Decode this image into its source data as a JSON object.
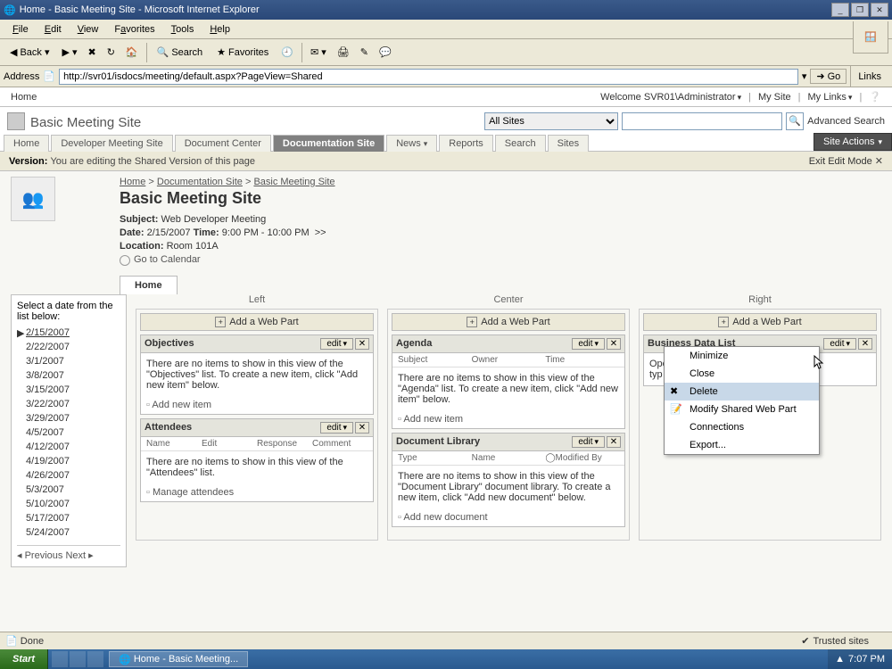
{
  "window": {
    "title": "Home - Basic Meeting Site - Microsoft Internet Explorer",
    "min": "_",
    "max": "▢",
    "restore": "❐",
    "close": "✕"
  },
  "menus": {
    "file": "File",
    "edit": "Edit",
    "view": "View",
    "favorites": "Favorites",
    "tools": "Tools",
    "help": "Help"
  },
  "toolbar": {
    "back": "Back",
    "search": "Search",
    "favorites": "Favorites"
  },
  "address": {
    "label": "Address",
    "url": "http://svr01/isdocs/meeting/default.aspx?PageView=Shared",
    "go": "Go",
    "links": "Links"
  },
  "sp_header": {
    "home": "Home",
    "welcome": "Welcome SVR01\\Administrator",
    "mysite": "My Site",
    "mylinks": "My Links"
  },
  "site_title": "Basic Meeting Site",
  "search": {
    "scope": "All Sites",
    "adv": "Advanced Search"
  },
  "tabs": [
    "Home",
    "Developer Meeting Site",
    "Document Center",
    "Documentation Site",
    "News",
    "Reports",
    "Search",
    "Sites"
  ],
  "active_tab": "Documentation Site",
  "site_actions": "Site Actions",
  "version": {
    "label": "Version:",
    "text": "You are editing the Shared Version of this page",
    "exit": "Exit Edit Mode",
    "x": "✕"
  },
  "breadcrumb": {
    "home": "Home",
    "doc": "Documentation Site",
    "bms": "Basic Meeting Site"
  },
  "page_title": "Basic Meeting Site",
  "meta": {
    "subject_label": "Subject:",
    "subject": "Web Developer Meeting",
    "date_label": "Date:",
    "date": "2/15/2007",
    "time_label": "Time:",
    "time": "9:00 PM - 10:00 PM",
    "more": ">>",
    "loc_label": "Location:",
    "loc": "Room 101A",
    "gotocal": "Go to Calendar"
  },
  "sidetab": "Home",
  "leftnav": {
    "prompt": "Select a date from the list below:",
    "dates": [
      "2/15/2007",
      "2/22/2007",
      "3/1/2007",
      "3/8/2007",
      "3/15/2007",
      "3/22/2007",
      "3/29/2007",
      "4/5/2007",
      "4/12/2007",
      "4/19/2007",
      "4/26/2007",
      "5/3/2007",
      "5/10/2007",
      "5/17/2007",
      "5/24/2007"
    ],
    "selected": "2/15/2007",
    "prev": "Previous",
    "next": "Next"
  },
  "zones": {
    "left": "Left",
    "center": "Center",
    "right": "Right",
    "addwp": "Add a Web Part"
  },
  "webparts": {
    "objectives": {
      "title": "Objectives",
      "empty": "There are no items to show in this view of the \"Objectives\" list. To create a new item, click \"Add new item\" below.",
      "add": "Add new item"
    },
    "attendees": {
      "title": "Attendees",
      "cols": [
        "Name",
        "Edit",
        "Response",
        "Comment"
      ],
      "empty": "There are no items to show in this view of the \"Attendees\" list.",
      "manage": "Manage attendees"
    },
    "agenda": {
      "title": "Agenda",
      "cols": [
        "Subject",
        "Owner",
        "Time"
      ],
      "empty": "There are no items to show in this view of the \"Agenda\" list. To create a new item, click \"Add new item\" below.",
      "add": "Add new item"
    },
    "doclib": {
      "title": "Document Library",
      "cols": [
        "Type",
        "Name",
        "Modified By"
      ],
      "empty": "There are no items to show in this view of the \"Document Library\" document library. To create a new item, click \"Add new document\" below.",
      "add": "Add new document"
    },
    "bdl": {
      "title": "Business Data List",
      "snippet": "Ope\ntyp"
    },
    "edit": "edit",
    "close": "✕"
  },
  "ctx": {
    "minimize": "Minimize",
    "close": "Close",
    "delete": "Delete",
    "modify": "Modify Shared Web Part",
    "connections": "Connections",
    "exportt": "Export..."
  },
  "status": {
    "done": "Done",
    "trusted": "Trusted sites"
  },
  "taskbar": {
    "start": "Start",
    "task": "Home - Basic Meeting...",
    "clock": "7:07 PM"
  }
}
